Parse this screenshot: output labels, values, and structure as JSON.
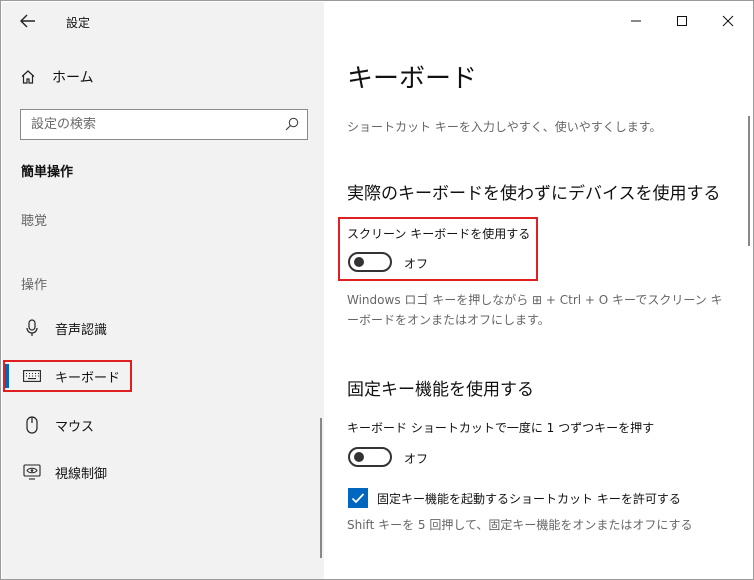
{
  "window": {
    "title": "設定",
    "controls": [
      "minimize",
      "maximize",
      "close"
    ]
  },
  "sidebar": {
    "home": {
      "label": "ホーム",
      "icon": "home-icon"
    },
    "search": {
      "placeholder": "設定の検索",
      "icon": "search-icon"
    },
    "section_title": "簡単操作",
    "groups": [
      {
        "label": "聴覚"
      },
      {
        "label": "操作"
      }
    ],
    "items": [
      {
        "label": "音声認識",
        "icon": "microphone-icon",
        "selected": false
      },
      {
        "label": "キーボード",
        "icon": "keyboard-icon",
        "selected": true
      },
      {
        "label": "マウス",
        "icon": "mouse-icon",
        "selected": false
      },
      {
        "label": "視線制御",
        "icon": "eye-control-icon",
        "selected": false
      }
    ]
  },
  "main": {
    "title": "キーボード",
    "description": "ショートカット キーを入力しやすく、使いやすくします。",
    "sections": [
      {
        "heading": "実際のキーボードを使わずにデバイスを使用する",
        "setting_label": "スクリーン キーボードを使用する",
        "toggle_state": "オフ",
        "toggle_on": false,
        "help_text": "Windows ロゴ キーを押しながら ⊞ + Ctrl + O キーでスクリーン キーボードをオンまたはオフにします。"
      },
      {
        "heading": "固定キー機能を使用する",
        "setting_label": "キーボード ショートカットで一度に 1 つずつキーを押す",
        "toggle_state": "オフ",
        "toggle_on": false,
        "checkbox_label": "固定キー機能を起動するショートカット キーを許可する",
        "checkbox_checked": true,
        "help_text": "Shift キーを 5 回押して、固定キー機能をオンまたはオフにする"
      }
    ]
  },
  "colors": {
    "accent": "#0067c0",
    "highlight": "#e02020",
    "sidebar_bg": "#f2f2f2"
  }
}
